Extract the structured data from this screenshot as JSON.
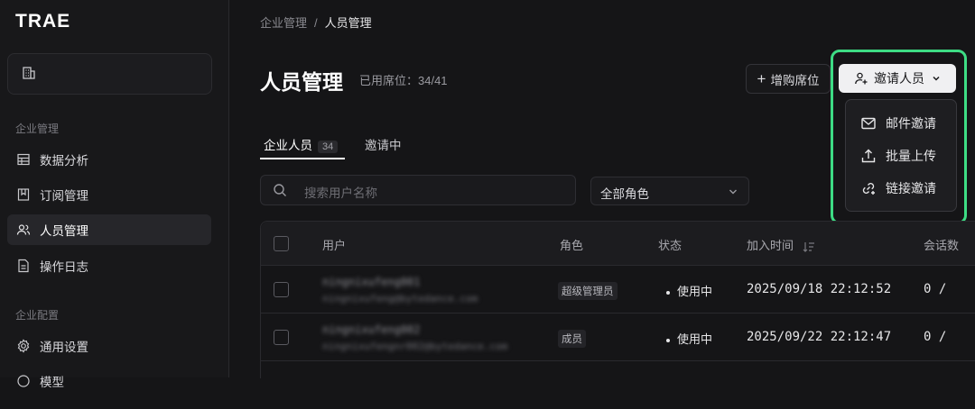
{
  "sidebar": {
    "logo": "TRAE",
    "section_enterprise_admin": "企业管理",
    "items": [
      {
        "label": "数据分析"
      },
      {
        "label": "订阅管理"
      },
      {
        "label": "人员管理"
      },
      {
        "label": "操作日志"
      }
    ],
    "section_enterprise_config": "企业配置",
    "config_items": [
      {
        "label": "通用设置"
      },
      {
        "label": "模型"
      }
    ]
  },
  "breadcrumb": {
    "parent": "企业管理",
    "separator": "/",
    "current": "人员管理"
  },
  "header": {
    "title": "人员管理",
    "seats_label": "已用席位：34/41",
    "buy_seats_label": "增购席位",
    "invite_label": "邀请人员"
  },
  "invite_menu": {
    "items": [
      {
        "label": "邮件邀请",
        "icon": "mail-icon"
      },
      {
        "label": "批量上传",
        "icon": "upload-icon"
      },
      {
        "label": "链接邀请",
        "icon": "link-add-icon"
      }
    ]
  },
  "tabs": [
    {
      "label": "企业人员",
      "count": "34"
    },
    {
      "label": "邀请中"
    }
  ],
  "search": {
    "placeholder": "搜索用户名称"
  },
  "role_filter": {
    "value": "全部角色"
  },
  "table": {
    "headers": {
      "user": "用户",
      "role": "角色",
      "status": "状态",
      "joined": "加入时间",
      "sessions": "会话数"
    },
    "rows": [
      {
        "name": "ningnixufeng001",
        "email": "ningnixufeng@bytedance.com",
        "role": "超级管理员",
        "status": "使用中",
        "joined": "2025/09/18 22:12:52",
        "sessions": "0 /"
      },
      {
        "name": "ningnixufeng002",
        "email": "ningnixufengnr002@bytedance.com",
        "role": "成员",
        "status": "使用中",
        "joined": "2025/09/22 22:12:47",
        "sessions": "0 /"
      }
    ]
  },
  "colors": {
    "highlight": "#3ddc84",
    "background": "#151517",
    "invite_button": "#f0f0f2"
  }
}
